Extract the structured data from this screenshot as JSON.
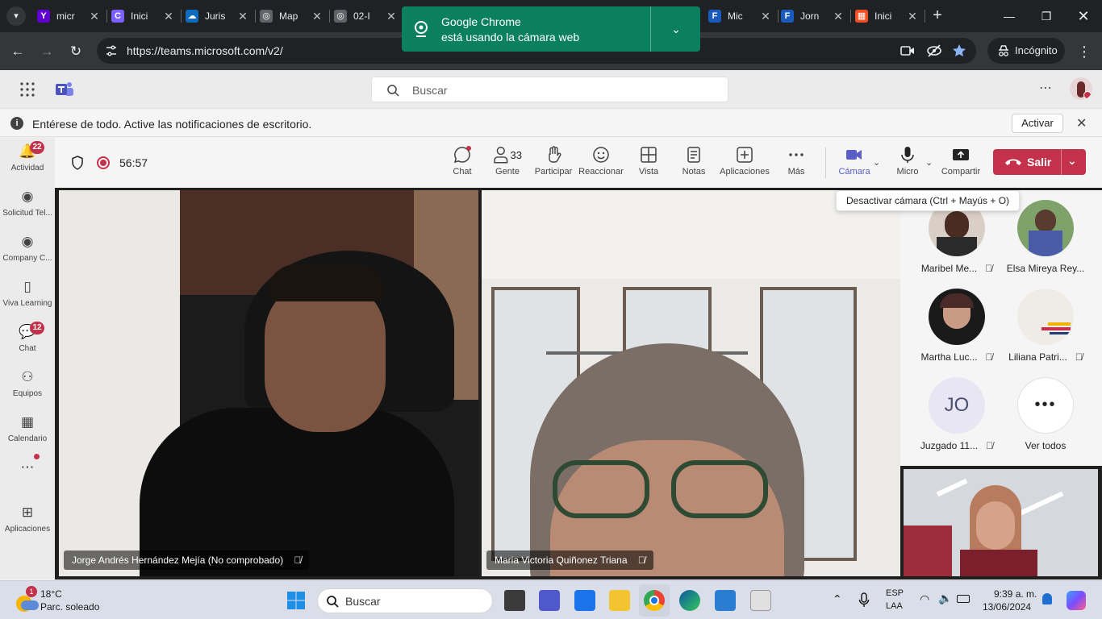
{
  "browser": {
    "tabs": [
      {
        "title": "micr",
        "fav_color": "#6001d2",
        "fav_glyph": "Y"
      },
      {
        "title": "Inici",
        "fav_color": "#7b61ff",
        "fav_glyph": "C"
      },
      {
        "title": "Juris",
        "fav_color": "#0f6cbd",
        "fav_glyph": "☁"
      },
      {
        "title": "Map",
        "fav_color": "#5f6368",
        "fav_glyph": "◎"
      },
      {
        "title": "02-I",
        "fav_color": "#5f6368",
        "fav_glyph": "◎"
      },
      {
        "title": "Mic",
        "fav_color": "#185abd",
        "fav_glyph": "F"
      },
      {
        "title": "Jorn",
        "fav_color": "#185abd",
        "fav_glyph": "F"
      },
      {
        "title": "Inici",
        "fav_color": "#f25022",
        "fav_glyph": "▦"
      }
    ],
    "url": "https://teams.microsoft.com/v2/",
    "incognito_label": "Incógnito",
    "camera_popup": {
      "line1": "Google Chrome",
      "line2": "está usando la cámara web"
    }
  },
  "teams": {
    "search_placeholder": "Buscar",
    "notification": {
      "message": "Entérese de todo. Active las notificaciones de escritorio.",
      "action": "Activar"
    },
    "rail": [
      {
        "label": "Actividad",
        "badge": "22",
        "icon": "bell-icon"
      },
      {
        "label": "Solicitud Tel...",
        "badge": "",
        "icon": "app-icon"
      },
      {
        "label": "Company C...",
        "badge": "",
        "icon": "app-icon"
      },
      {
        "label": "Viva Learning",
        "badge": "",
        "icon": "book-icon"
      },
      {
        "label": "Chat",
        "badge": "12",
        "icon": "chat-icon"
      },
      {
        "label": "Equipos",
        "badge": "",
        "icon": "teams-icon"
      },
      {
        "label": "Calendario",
        "badge": "",
        "icon": "calendar-icon"
      },
      {
        "label": "",
        "badge": "",
        "icon": "more-icon"
      },
      {
        "label": "Aplicaciones",
        "badge": "",
        "icon": "add-apps-icon"
      }
    ],
    "meeting": {
      "timer": "56:57",
      "people_count": "33",
      "tools": {
        "chat": "Chat",
        "people": "Gente",
        "raise": "Participar",
        "react": "Reaccionar",
        "view": "Vista",
        "notes": "Notas",
        "apps": "Aplicaciones",
        "more": "Más",
        "camera": "Cámara",
        "mic": "Micro",
        "share": "Compartir",
        "leave": "Salir"
      },
      "tooltip": "Desactivar cámara (Ctrl + Mayús + O)",
      "tiles": [
        {
          "name": "Jorge Andrés Hernández Mejía (No comprobado)"
        },
        {
          "name": "Maria Victoria Quiñonez Triana"
        }
      ],
      "gallery": [
        {
          "name": "Maribel Me..."
        },
        {
          "name": "Elsa Mireya Rey..."
        },
        {
          "name": "Martha Luc..."
        },
        {
          "name": "Liliana Patri..."
        },
        {
          "name": "Juzgado 11...",
          "initials": "JO"
        },
        {
          "name": "Ver todos"
        }
      ]
    }
  },
  "taskbar": {
    "weather_temp": "18°C",
    "weather_desc": "Parc. soleado",
    "weather_badge": "1",
    "search_placeholder": "Buscar",
    "lang_line1": "ESP",
    "lang_line2": "LAA",
    "time": "9:39 a. m.",
    "date": "13/06/2024"
  }
}
